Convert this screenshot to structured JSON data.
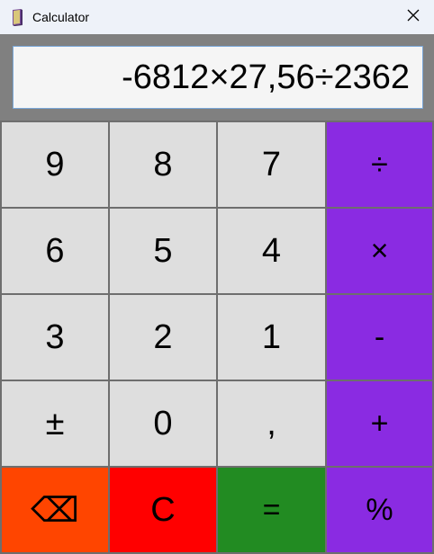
{
  "window": {
    "title": "Calculator",
    "close_symbol": "✕"
  },
  "display": {
    "expression": "-6812×27,56÷2362"
  },
  "keys": {
    "row1": [
      "9",
      "8",
      "7",
      "÷"
    ],
    "row2": [
      "6",
      "5",
      "4",
      "×"
    ],
    "row3": [
      "3",
      "2",
      "1",
      "-"
    ],
    "row4": [
      "±",
      "0",
      ",",
      "+"
    ],
    "row5": [
      "⌫",
      "C",
      "=",
      "%"
    ]
  },
  "colors": {
    "number_key": "#dedede",
    "operator_key": "#8a2be2",
    "backspace_key": "#ff4500",
    "clear_key": "#ff0000",
    "equals_key": "#228b22",
    "background": "#808080"
  },
  "icons": {
    "app": "calculator-book-icon",
    "close": "close-icon"
  }
}
